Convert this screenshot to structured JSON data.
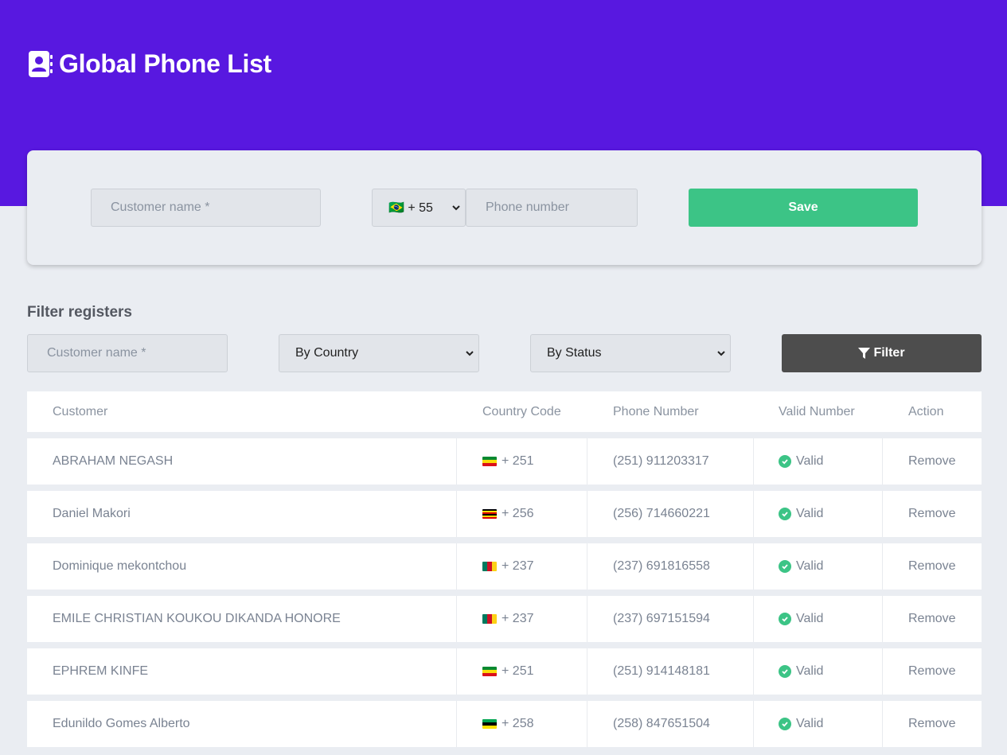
{
  "header": {
    "title": "Global Phone List",
    "icon": "address-book-icon"
  },
  "form": {
    "name_placeholder": "Customer name *",
    "country_code_selected": "🇧🇷 + 55",
    "phone_placeholder": "Phone number",
    "save_label": "Save"
  },
  "filter": {
    "title": "Filter registers",
    "name_placeholder": "Customer name *",
    "country_selected": "By Country",
    "status_selected": "By Status",
    "button_label": "Filter"
  },
  "table": {
    "headers": [
      "Customer",
      "Country Code",
      "Phone Number",
      "Valid Number",
      "Action"
    ],
    "rows": [
      {
        "customer": "ABRAHAM NEGASH",
        "code": "+ 251",
        "flag": "ethiopia",
        "phone": "(251) 911203317",
        "valid": "Valid",
        "action": "Remove"
      },
      {
        "customer": "Daniel Makori",
        "code": "+ 256",
        "flag": "uganda",
        "phone": "(256) 714660221",
        "valid": "Valid",
        "action": "Remove"
      },
      {
        "customer": "Dominique mekontchou",
        "code": "+ 237",
        "flag": "cameroon",
        "phone": "(237) 691816558",
        "valid": "Valid",
        "action": "Remove"
      },
      {
        "customer": "EMILE CHRISTIAN KOUKOU DIKANDA HONORE",
        "code": "+ 237",
        "flag": "cameroon",
        "phone": "(237) 697151594",
        "valid": "Valid",
        "action": "Remove"
      },
      {
        "customer": "EPHREM KINFE",
        "code": "+ 251",
        "flag": "ethiopia",
        "phone": "(251) 914148181",
        "valid": "Valid",
        "action": "Remove"
      },
      {
        "customer": "Edunildo Gomes Alberto",
        "code": "+ 258",
        "flag": "mozambique",
        "phone": "(258) 847651504",
        "valid": "Valid",
        "action": "Remove"
      }
    ]
  },
  "colors": {
    "brand": "#5818e0",
    "save": "#3cc486",
    "filter": "#4d4d4d",
    "valid": "#3cc486"
  }
}
